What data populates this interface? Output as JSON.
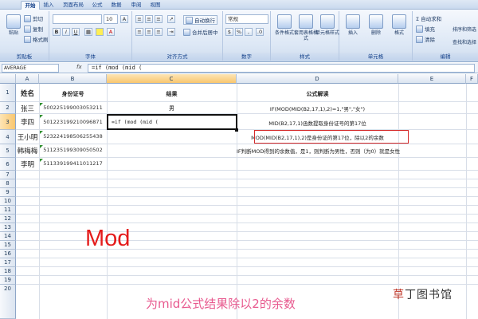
{
  "ribbon": {
    "tabs": [
      "开始",
      "插入",
      "页面布局",
      "公式",
      "数据",
      "审阅",
      "视图"
    ],
    "clipboard": {
      "paste": "粘贴",
      "cut": "剪切",
      "copy": "复制",
      "format_painter": "格式刷",
      "label": "剪贴板"
    },
    "font": {
      "label": "字体",
      "size": "10"
    },
    "alignment": {
      "wrap": "自动换行",
      "merge": "合并后居中",
      "label": "对齐方式"
    },
    "number": {
      "format": "常规",
      "label": "数字"
    },
    "styles": {
      "conditional": "条件格式",
      "table": "套用表格格式",
      "cell": "单元格样式",
      "label": "样式"
    },
    "cells": {
      "insert": "插入",
      "delete": "删除",
      "format": "格式",
      "label": "单元格"
    },
    "editing": {
      "autosum": "Σ 自动求和",
      "fill": "填充",
      "clear": "清除",
      "sort": "排序和筛选",
      "find": "查找和选择",
      "label": "编辑"
    }
  },
  "formula_bar": {
    "name_box": "AVERAGE",
    "fx": "fx",
    "formula": "=if (mod (mid ("
  },
  "columns": [
    "A",
    "B",
    "C",
    "D",
    "E",
    "F"
  ],
  "rows": [
    "1",
    "2",
    "3",
    "4",
    "5",
    "6",
    "7",
    "8",
    "9",
    "10",
    "11",
    "12",
    "13",
    "14",
    "15",
    "16",
    "17",
    "18",
    "19",
    "20"
  ],
  "headers": {
    "name": "姓名",
    "id": "身份证号",
    "result": "结果",
    "explain": "公式解读"
  },
  "table": [
    {
      "name": "张三",
      "id": "500225199003053211",
      "result": "男",
      "explain": "IF(MOD(MID(B2,17,1),2)=1,\"男\",\"女\")"
    },
    {
      "name": "李四",
      "id": "501223199210096871",
      "result": "=if (mod (mid (",
      "explain": "MID(B2,17,1)函数提取身份证号的第17位"
    },
    {
      "name": "王小明",
      "id": "523224198506255438",
      "result": "",
      "explain": "MOD(MID(B2,17,1),2)是身份证的第17位，除以2的余数"
    },
    {
      "name": "韩梅梅",
      "id": "511235199309050502",
      "result": "",
      "explain": "IF判断MOD得到的余数值，是1，则判断为男性，否则（为0）就是女性"
    },
    {
      "name": "李明",
      "id": "511339199411011217",
      "result": "",
      "explain": ""
    }
  ],
  "overlay": {
    "mod": "Mod",
    "caption": "为mid公式结果除以2的余数",
    "watermark_first": "草",
    "watermark_rest": "丁图书馆"
  },
  "colors": {
    "highlight_box": "#d42a2a",
    "mod_text": "#e41b1b",
    "caption": "#e85a8f"
  }
}
